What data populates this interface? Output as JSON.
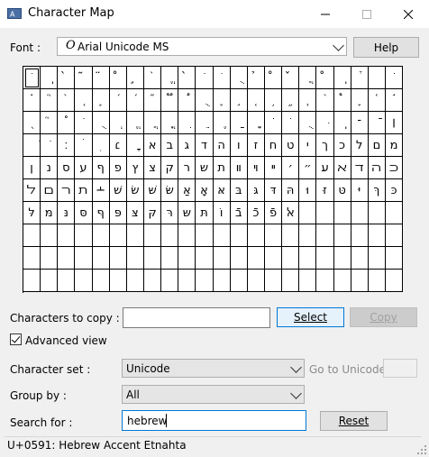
{
  "window": {
    "title": "Character Map"
  },
  "font": {
    "label": "Font :",
    "value": "Arial Unicode MS",
    "font_icon_glyph": "O",
    "help_label": "Help"
  },
  "grid": {
    "rows": [
      [
        "ֺ",
        "ֽ",
        "̀",
        "̃",
        "̈",
        "̊",
        "̧",
        "֙",
        "ֱ",
        "̀",
        "ֹ",
        "ֺ",
        "ֻ",
        "̉",
        "̊",
        "̌",
        "ֲ",
        "̊",
        "ֽ",
        "֒",
        "",
        "ֹ"
      ],
      [
        "֗",
        "֘",
        "֙",
        "֚",
        "֛",
        "֜",
        "֝",
        "֞",
        "֟",
        "֠",
        "ֻ",
        "֢",
        "֣",
        "֤",
        "֥",
        "֦",
        "֧",
        "֨",
        "֩",
        "֪",
        "֫",
        "֬"
      ],
      [
        "֭",
        "֮",
        "֯",
        "ֺ",
        "ֻ",
        "ְ",
        "ֱ",
        "ֲ",
        "ֳ",
        "ִ",
        "ֵ",
        "ֶ",
        "ַ",
        "ָ",
        "ֹ",
        "ֺ",
        "ֻ",
        "ּ",
        "ֽ",
        "־",
        "ֿ",
        "׀"
      ],
      [
        "ׁ",
        "ׂ",
        "׃",
        "ׄ",
        "ׅ",
        "׆",
        "ׇ",
        "א",
        "ב",
        "ג",
        "ד",
        "ה",
        "ו",
        "ז",
        "ח",
        "ט",
        "י",
        "ך",
        "כ",
        "ל",
        "ם",
        "מ"
      ],
      [
        "ן",
        "נ",
        "ס",
        "ע",
        "ף",
        "פ",
        "ץ",
        "צ",
        "ק",
        "ר",
        "ש",
        "ת",
        "װ",
        "ױ",
        "ײ",
        "׳",
        "״",
        "ﬠ",
        "ﬡ",
        "ﬢ",
        "ﬣ",
        "ﬤ"
      ],
      [
        "ﬥ",
        "ﬦ",
        "ﬧ",
        "ﬨ",
        "﬩",
        "שׁ",
        "שׂ",
        "שּׁ",
        "שּׂ",
        "אַ",
        "אָ",
        "אּ",
        "בּ",
        "גּ",
        "דּ",
        "הּ",
        "וּ",
        "זּ",
        "טּ",
        "יּ",
        "ךּ",
        "כּ"
      ],
      [
        "לּ",
        "מּ",
        "נּ",
        "סּ",
        "ףּ",
        "פּ",
        "צּ",
        "קּ",
        "רּ",
        "שּ",
        "תּ",
        "וֹ",
        "בֿ",
        "כֿ",
        "פֿ",
        "ﭏ",
        "",
        "",
        "",
        "",
        "",
        ""
      ],
      [
        "",
        "",
        "",
        "",
        "",
        "",
        "",
        "",
        "",
        "",
        "",
        "",
        "",
        "",
        "",
        "",
        "",
        "",
        "",
        "",
        "",
        ""
      ],
      [
        "",
        "",
        "",
        "",
        "",
        "",
        "",
        "",
        "",
        "",
        "",
        "",
        "",
        "",
        "",
        "",
        "",
        "",
        "",
        "",
        "",
        ""
      ],
      [
        "",
        "",
        "",
        "",
        "",
        "",
        "",
        "",
        "",
        "",
        "",
        "",
        "",
        "",
        "",
        "",
        "",
        "",
        "",
        "",
        "",
        ""
      ]
    ]
  },
  "copy": {
    "label": "Characters to copy :",
    "value": "",
    "select_label": "Select",
    "copy_label": "Copy"
  },
  "advanced": {
    "label": "Advanced view",
    "checked": true
  },
  "charset": {
    "label": "Character set :",
    "value": "Unicode",
    "goto_label": "Go to Unicode :",
    "goto_value": ""
  },
  "groupby": {
    "label": "Group by :",
    "value": "All"
  },
  "search": {
    "label": "Search for :",
    "value": "hebrew",
    "reset_label": "Reset"
  },
  "status": {
    "text": "U+0591: Hebrew Accent Etnahta"
  }
}
